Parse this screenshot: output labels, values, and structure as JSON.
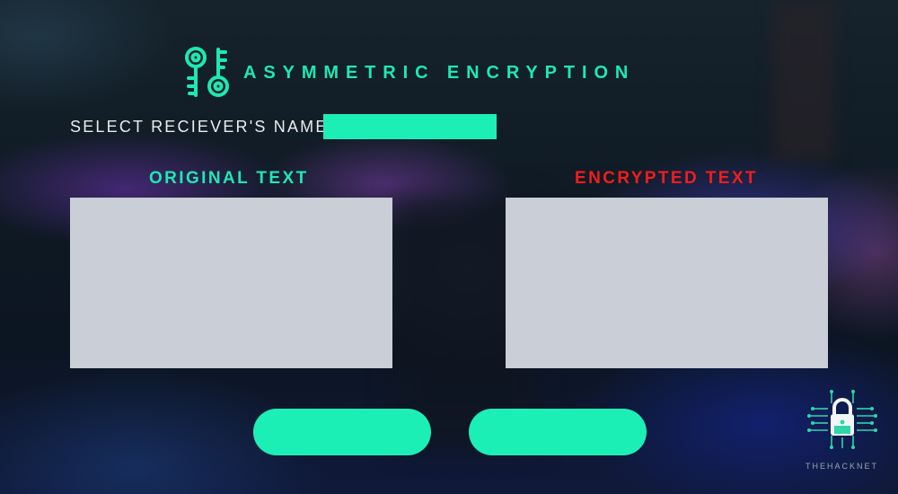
{
  "header": {
    "icon": "keys-icon",
    "title": "ASYMMETRIC ENCRYPTION"
  },
  "receiver": {
    "label": "SELECT RECIEVER'S NAME:",
    "value": ""
  },
  "panes": {
    "original_heading": "ORIGINAL TEXT",
    "encrypted_heading": "ENCRYPTED TEXT",
    "original_value": "",
    "encrypted_value": ""
  },
  "buttons": {
    "left_label": "",
    "right_label": ""
  },
  "branding": {
    "logo_icon": "circuit-lock-icon",
    "name": "THEHACKNET"
  },
  "colors": {
    "accent": "#1ee8b2",
    "field": "#1cefb6",
    "danger": "#f21d1d",
    "panel": "#c9ced7"
  }
}
